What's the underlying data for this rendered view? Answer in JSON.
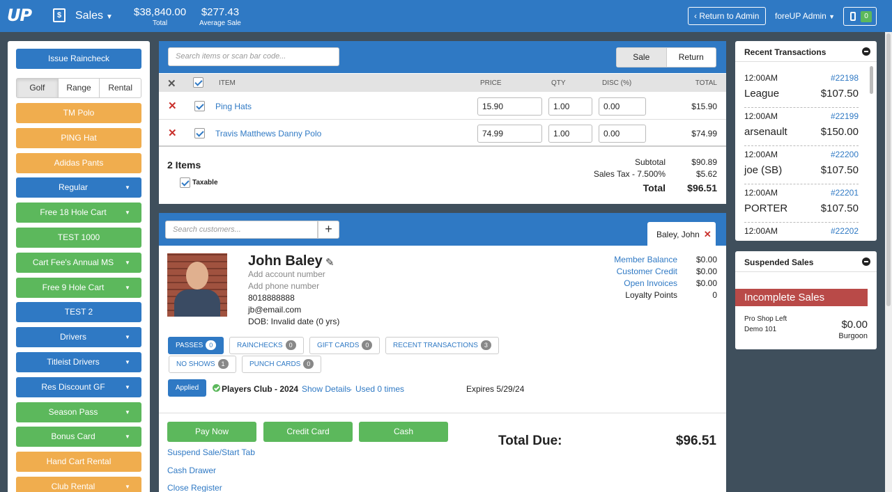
{
  "topbar": {
    "logo": "UP",
    "register_icon": "dollar-register-icon",
    "module": "Sales",
    "total_value": "$38,840.00",
    "total_label": "Total",
    "avg_value": "$277.43",
    "avg_label": "Average Sale",
    "return_admin": "Return to Admin",
    "admin_user": "foreUP Admin",
    "device_count": "0"
  },
  "colors": {
    "primary": "#2f79c4",
    "green": "#5cb85c",
    "orange": "#f0ad4e",
    "danger": "#c9302c",
    "dark_bg": "#3f4f5c"
  },
  "left": {
    "raincheck": "Issue Raincheck",
    "categories": [
      "Golf",
      "Range",
      "Rental"
    ],
    "active_category": "Golf",
    "buttons": [
      {
        "label": "TM Polo",
        "color": "orange",
        "dropdown": false
      },
      {
        "label": "PING Hat",
        "color": "orange",
        "dropdown": false
      },
      {
        "label": "Adidas Pants",
        "color": "orange",
        "dropdown": false
      },
      {
        "label": "Regular",
        "color": "blue",
        "dropdown": true
      },
      {
        "label": "Free 18 Hole Cart",
        "color": "green",
        "dropdown": true
      },
      {
        "label": "TEST 1000",
        "color": "green",
        "dropdown": false
      },
      {
        "label": "Cart Fee's Annual MS",
        "color": "green",
        "dropdown": true
      },
      {
        "label": "Free 9 Hole Cart",
        "color": "green",
        "dropdown": true
      },
      {
        "label": "TEST 2",
        "color": "blue",
        "dropdown": false
      },
      {
        "label": "Drivers",
        "color": "blue",
        "dropdown": true
      },
      {
        "label": "Titleist Drivers",
        "color": "blue",
        "dropdown": true
      },
      {
        "label": "Res Discount GF",
        "color": "blue",
        "dropdown": true
      },
      {
        "label": "Season Pass",
        "color": "green",
        "dropdown": true
      },
      {
        "label": "Bonus Card",
        "color": "green",
        "dropdown": true
      },
      {
        "label": "Hand Cart Rental",
        "color": "orange",
        "dropdown": false
      },
      {
        "label": "Club Rental",
        "color": "orange",
        "dropdown": true
      }
    ]
  },
  "cart": {
    "search_placeholder": "Search items or scan bar code...",
    "mode_sale": "Sale",
    "mode_return": "Return",
    "headers": {
      "item": "ITEM",
      "price": "PRICE",
      "qty": "QTY",
      "disc": "DISC (%)",
      "total": "TOTAL"
    },
    "items": [
      {
        "name": "Ping Hats",
        "price": "15.90",
        "qty": "1.00",
        "disc": "0.00",
        "total": "$15.90"
      },
      {
        "name": "Travis Matthews Danny Polo",
        "price": "74.99",
        "qty": "1.00",
        "disc": "0.00",
        "total": "$74.99"
      }
    ],
    "item_count": "2 Items",
    "taxable": "Taxable",
    "subtotal_label": "Subtotal",
    "subtotal": "$90.89",
    "tax_label": "Sales Tax - 7.500%",
    "tax": "$5.62",
    "total_label": "Total",
    "total": "$96.51"
  },
  "customer": {
    "search_placeholder": "Search customers...",
    "tab": "Baley, John",
    "name": "John Baley",
    "account": "Add account number",
    "phone": "Add phone number",
    "number": "8018888888",
    "email": "jb@email.com",
    "dob": "DOB: Invalid date (0 yrs)",
    "balances": [
      {
        "label": "Member Balance",
        "value": "$0.00",
        "link": true
      },
      {
        "label": "Customer Credit",
        "value": "$0.00",
        "link": true
      },
      {
        "label": "Open Invoices",
        "value": "$0.00",
        "link": true
      },
      {
        "label": "Loyalty Points",
        "value": "0",
        "link": false
      }
    ],
    "pills": [
      {
        "label": "PASSES",
        "count": "0",
        "active": true
      },
      {
        "label": "RAINCHECKS",
        "count": "0",
        "active": false
      },
      {
        "label": "GIFT CARDS",
        "count": "0",
        "active": false
      },
      {
        "label": "RECENT TRANSACTIONS",
        "count": "3",
        "active": false
      },
      {
        "label": "NO SHOWS",
        "count": "1",
        "active": false
      },
      {
        "label": "PUNCH CARDS",
        "count": "0",
        "active": false
      }
    ],
    "applied": "Applied",
    "pass_name": "Players Club - 2024",
    "show_details": "Show Details",
    "sep": " - ",
    "used": "Used 0 times",
    "expires": "Expires 5/29/24"
  },
  "pay": {
    "pay_now": "Pay Now",
    "credit_card": "Credit Card",
    "cash": "Cash",
    "suspend": "Suspend Sale/Start Tab",
    "cash_drawer": "Cash Drawer",
    "close_register": "Close Register",
    "due_label": "Total Due:",
    "due_value": "$96.51"
  },
  "recent": {
    "title": "Recent Transactions",
    "items": [
      {
        "time": "12:00AM",
        "id": "#22198",
        "customer": "League",
        "amount": "$107.50"
      },
      {
        "time": "12:00AM",
        "id": "#22199",
        "customer": "arsenault",
        "amount": "$150.00"
      },
      {
        "time": "12:00AM",
        "id": "#22200",
        "customer": "joe (SB)",
        "amount": "$107.50"
      },
      {
        "time": "12:00AM",
        "id": "#22201",
        "customer": "PORTER",
        "amount": "$107.50"
      },
      {
        "time": "12:00AM",
        "id": "#22202",
        "customer": "",
        "amount": ""
      }
    ]
  },
  "suspended": {
    "title": "Suspended Sales",
    "banner": "Incomplete Sales",
    "location": "Pro Shop Left",
    "terminal": "Demo 101",
    "amount": "$0.00",
    "employee": "Burgoon"
  }
}
